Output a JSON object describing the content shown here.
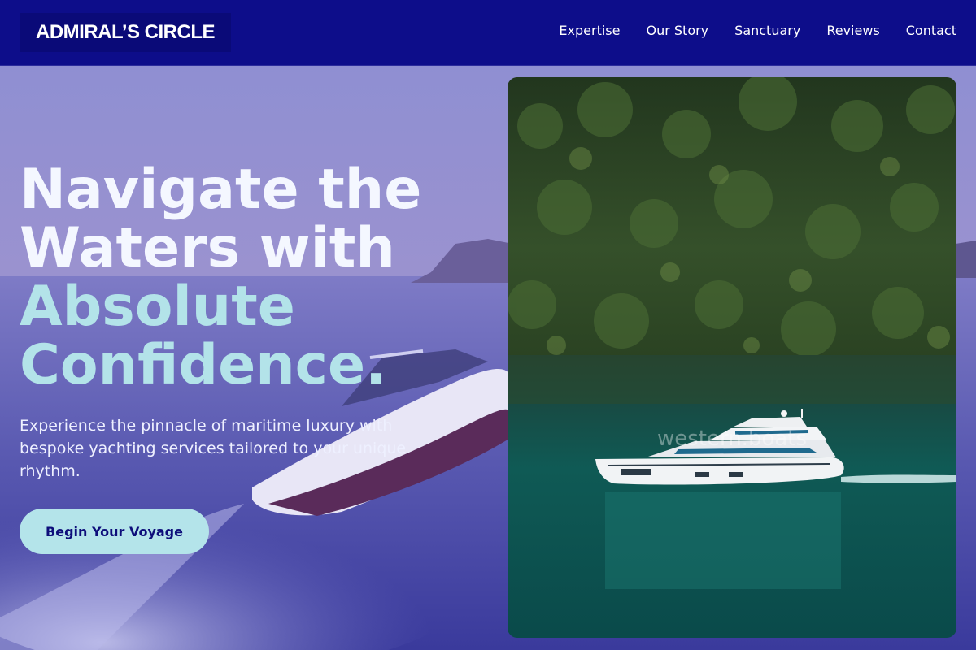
{
  "header": {
    "logo": "ADMIRAL’S CIRCLE",
    "nav": [
      "Expertise",
      "Our Story",
      "Sanctuary",
      "Reviews",
      "Contact"
    ]
  },
  "hero": {
    "headline_line1": "Navigate the",
    "headline_line2": "Waters with",
    "headline_line3": "Absolute",
    "headline_line4": "Confidence.",
    "subcopy": "Experience the pinnacle of maritime luxury with bespoke yachting services tailored to your unique rhythm.",
    "cta_label": "Begin Your Voyage"
  },
  "image_card": {
    "watermark": "western.boats"
  },
  "colors": {
    "header_bg": "#0d0d8a",
    "accent": "#b4e4ea",
    "headline_white": "#f4f7ff"
  }
}
